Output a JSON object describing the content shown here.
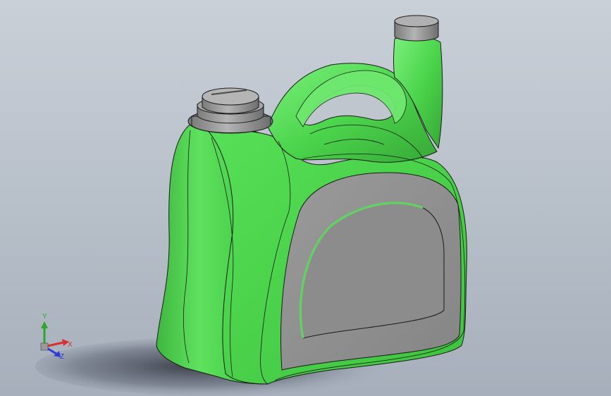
{
  "viewport": {
    "background_top": "#c9d0d8",
    "background_bottom": "#a6afbb",
    "model": {
      "body_color": "#4fd84f",
      "body_shadow_color": "#2f9a2f",
      "label_color": "#8f8f8f",
      "cap_color": "#9a9a9a",
      "edge_color": "#1a1a1a"
    }
  },
  "triad": {
    "x_label": "X",
    "y_label": "Y",
    "z_label": "Z",
    "x_color": "#d83030",
    "y_color": "#2ea62e",
    "z_color": "#2e3ad8"
  }
}
